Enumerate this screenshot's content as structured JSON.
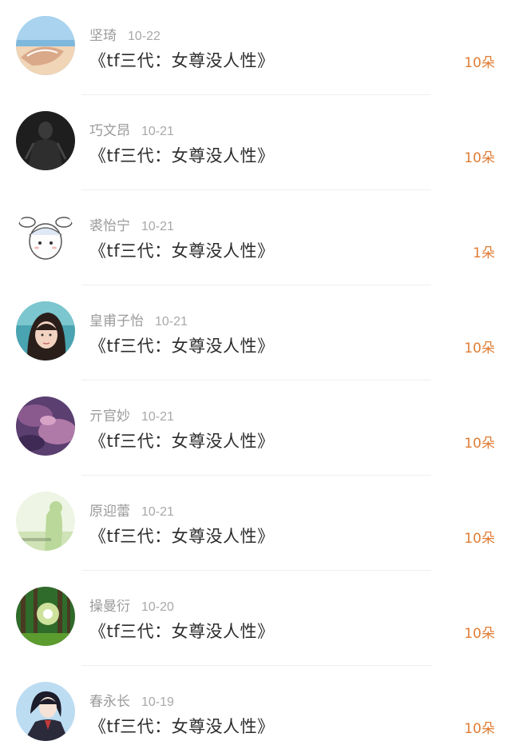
{
  "items": [
    {
      "name": "坚琦",
      "date": "10-22",
      "title": "《tf三代：女尊没人性》",
      "count": "10朵",
      "avatar": "avatar-beach"
    },
    {
      "name": "巧文昂",
      "date": "10-21",
      "title": "《tf三代：女尊没人性》",
      "count": "10朵",
      "avatar": "avatar-dark-figure"
    },
    {
      "name": "裘怡宁",
      "date": "10-21",
      "title": "《tf三代：女尊没人性》",
      "count": "1朵",
      "avatar": "avatar-cartoon-bunny"
    },
    {
      "name": "皇甫子怡",
      "date": "10-21",
      "title": "《tf三代：女尊没人性》",
      "count": "10朵",
      "avatar": "avatar-girl-portrait"
    },
    {
      "name": "亓官妙",
      "date": "10-21",
      "title": "《tf三代：女尊没人性》",
      "count": "10朵",
      "avatar": "avatar-purple-sky"
    },
    {
      "name": "原迎蕾",
      "date": "10-21",
      "title": "《tf三代：女尊没人性》",
      "count": "10朵",
      "avatar": "avatar-green-silhouette"
    },
    {
      "name": "操曼衍",
      "date": "10-20",
      "title": "《tf三代：女尊没人性》",
      "count": "10朵",
      "avatar": "avatar-forest-sun"
    },
    {
      "name": "春永长",
      "date": "10-19",
      "title": "《tf三代：女尊没人性》",
      "count": "10朵",
      "avatar": "avatar-anime-character"
    }
  ]
}
